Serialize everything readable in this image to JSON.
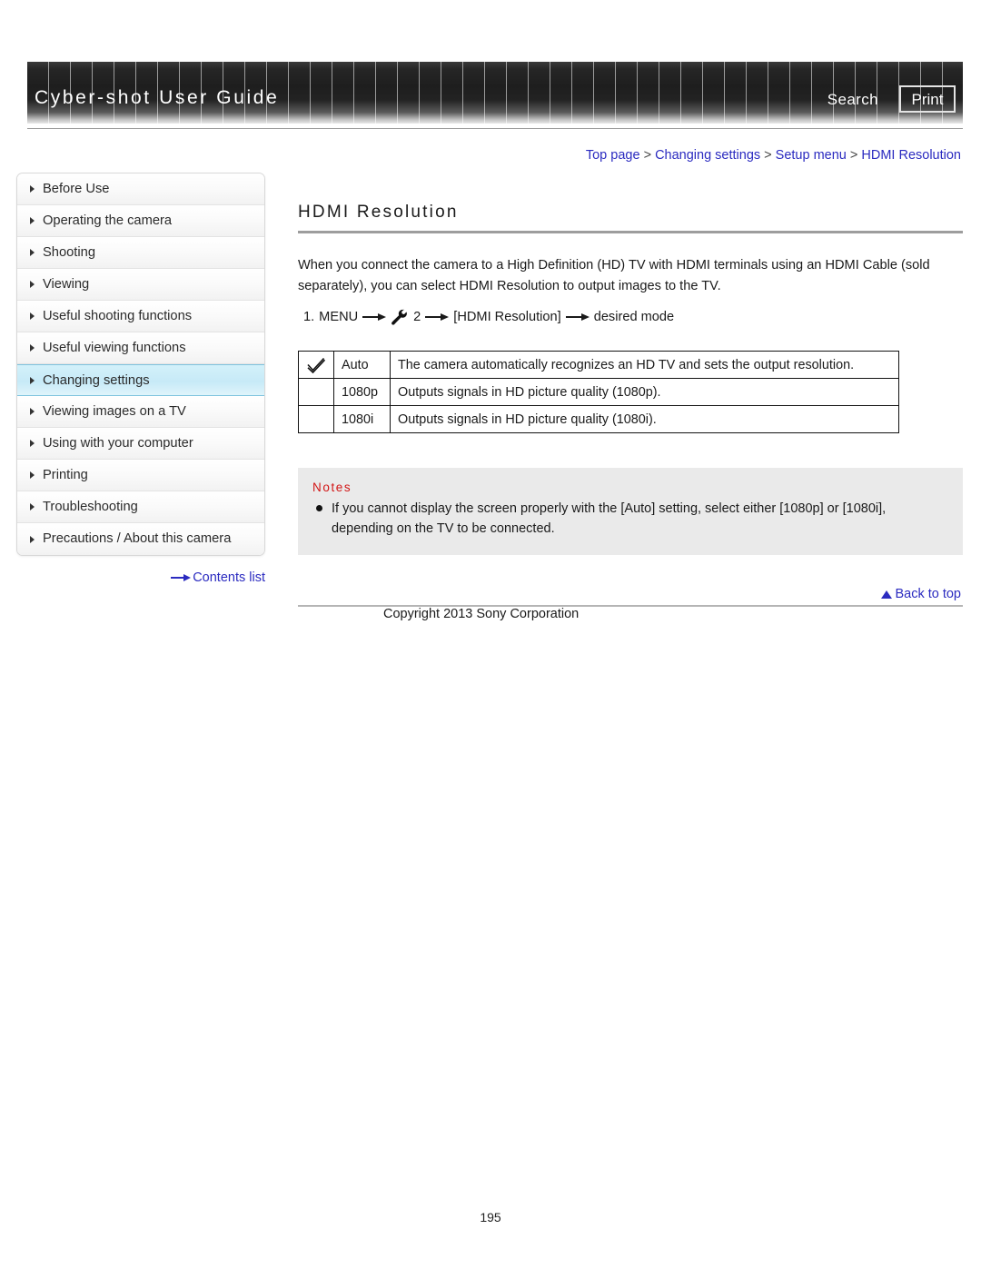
{
  "header": {
    "title": "Cyber-shot User Guide",
    "search_label": "Search",
    "print_label": "Print"
  },
  "breadcrumb": {
    "items": [
      "Top page",
      "Changing settings",
      "Setup menu",
      "HDMI Resolution"
    ],
    "separator": ">"
  },
  "sidebar": {
    "items": [
      {
        "label": "Before Use",
        "active": false
      },
      {
        "label": "Operating the camera",
        "active": false
      },
      {
        "label": "Shooting",
        "active": false
      },
      {
        "label": "Viewing",
        "active": false
      },
      {
        "label": "Useful shooting functions",
        "active": false
      },
      {
        "label": "Useful viewing functions",
        "active": false
      },
      {
        "label": "Changing settings",
        "active": true
      },
      {
        "label": "Viewing images on a TV",
        "active": false
      },
      {
        "label": "Using with your computer",
        "active": false
      },
      {
        "label": "Printing",
        "active": false
      },
      {
        "label": "Troubleshooting",
        "active": false
      },
      {
        "label": "Precautions / About this camera",
        "active": false
      }
    ],
    "contents_link": "Contents list"
  },
  "main": {
    "title": "HDMI Resolution",
    "intro": "When you connect the camera to a High Definition (HD) TV with HDMI terminals using an HDMI Cable (sold separately), you can select HDMI Resolution to output images to the TV.",
    "step": {
      "number": "1.",
      "menu_label": "MENU",
      "setup_number": "2",
      "setting_label": "[HDMI Resolution]",
      "result_label": "desired mode",
      "wrench_icon": "wrench-icon"
    },
    "options_table": {
      "rows": [
        {
          "selected": true,
          "check_icon": "check-mark-icon",
          "label": "Auto",
          "description": "The camera automatically recognizes an HD TV and sets the output resolution."
        },
        {
          "selected": false,
          "check_icon": "",
          "label": "1080p",
          "description": "Outputs signals in HD picture quality (1080p)."
        },
        {
          "selected": false,
          "check_icon": "",
          "label": "1080i",
          "description": "Outputs signals in HD picture quality (1080i)."
        }
      ]
    },
    "notes": {
      "title": "Notes",
      "items": [
        "If you cannot display the screen properly with the [Auto] setting, select either [1080p] or [1080i], depending on the TV to be connected."
      ]
    }
  },
  "footer": {
    "back_to_top": "Back to top",
    "copyright": "Copyright 2013 Sony Corporation",
    "page_number": "195"
  },
  "colors": {
    "link": "#2b2bc0",
    "notes_title": "#d21515",
    "active_nav": "#c7eaf7",
    "notes_bg": "#eaeaea"
  }
}
